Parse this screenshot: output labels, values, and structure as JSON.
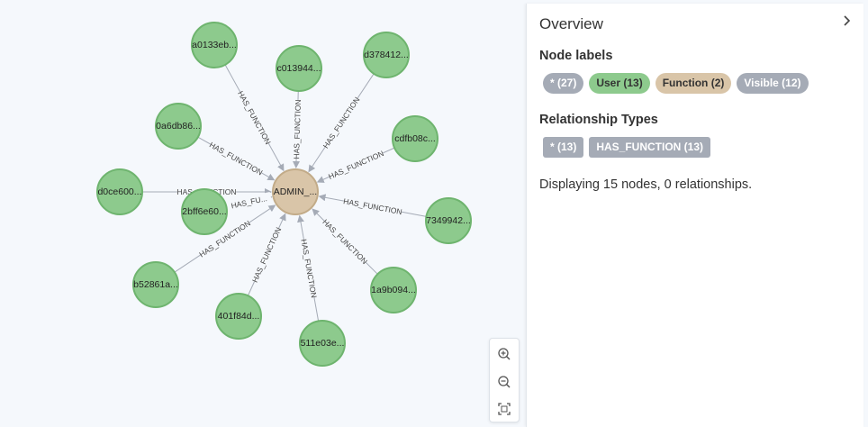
{
  "graph": {
    "center": {
      "label": "ADMIN_...",
      "color": "#d9c5a8",
      "stroke": "#c2ab88"
    },
    "relationship_type": "HAS_FUNCTION",
    "user_node_color": "#8dca8d",
    "user_node_stroke": "#6eb46e",
    "nodes": [
      {
        "id": "n1",
        "label": "a0133eb..."
      },
      {
        "id": "n2",
        "label": "c013944..."
      },
      {
        "id": "n3",
        "label": "d378412..."
      },
      {
        "id": "n4",
        "label": "0a6db86..."
      },
      {
        "id": "n5",
        "label": "cdfb08c..."
      },
      {
        "id": "n6",
        "label": "d0ce600..."
      },
      {
        "id": "n7",
        "label": "2bff6e60..."
      },
      {
        "id": "n8",
        "label": "7349942..."
      },
      {
        "id": "n9",
        "label": "b52861a..."
      },
      {
        "id": "n10",
        "label": "1a9b094..."
      },
      {
        "id": "n11",
        "label": "401f84d..."
      },
      {
        "id": "n12",
        "label": "511e03e..."
      }
    ],
    "edges": [
      {
        "from": "n1",
        "label": "HAS_FUNCTION"
      },
      {
        "from": "n2",
        "label": "HAS_FUNCTION"
      },
      {
        "from": "n3",
        "label": "HAS_FUNCTION"
      },
      {
        "from": "n4",
        "label": "HAS_FUNCTION"
      },
      {
        "from": "n5",
        "label": "HAS_FUNCTION"
      },
      {
        "from": "n6",
        "label": "HAS_FUNCTION"
      },
      {
        "from": "n7",
        "label": "HAS_FU..."
      },
      {
        "from": "n8",
        "label": "HAS_FUNCTION"
      },
      {
        "from": "n9",
        "label": "HAS_FUNCTION"
      },
      {
        "from": "n10",
        "label": "HAS_FUNCTION"
      },
      {
        "from": "n11",
        "label": "HAS_FUNCTION"
      },
      {
        "from": "n12",
        "label": "HAS_FUNCTION"
      }
    ]
  },
  "toolbar": {
    "zoom_in_icon": "zoom-in-icon",
    "zoom_out_icon": "zoom-out-icon",
    "fit_icon": "fit-to-screen-icon"
  },
  "overview": {
    "title": "Overview",
    "collapse_icon": "chevron-right-icon",
    "node_labels_heading": "Node labels",
    "node_labels": [
      {
        "text": "* (27)",
        "color": "#a5abb6",
        "tone": "dark"
      },
      {
        "text": "User (13)",
        "color": "#8dca8d",
        "tone": "light"
      },
      {
        "text": "Function (2)",
        "color": "#d9c5a8",
        "tone": "light"
      },
      {
        "text": "Visible (12)",
        "color": "#a5abb6",
        "tone": "dark"
      }
    ],
    "relationship_types_heading": "Relationship Types",
    "relationship_types": [
      {
        "text": "* (13)",
        "color": "#a5abb6"
      },
      {
        "text": "HAS_FUNCTION (13)",
        "color": "#a5abb6"
      }
    ],
    "summary": "Displaying 15 nodes, 0 relationships."
  }
}
